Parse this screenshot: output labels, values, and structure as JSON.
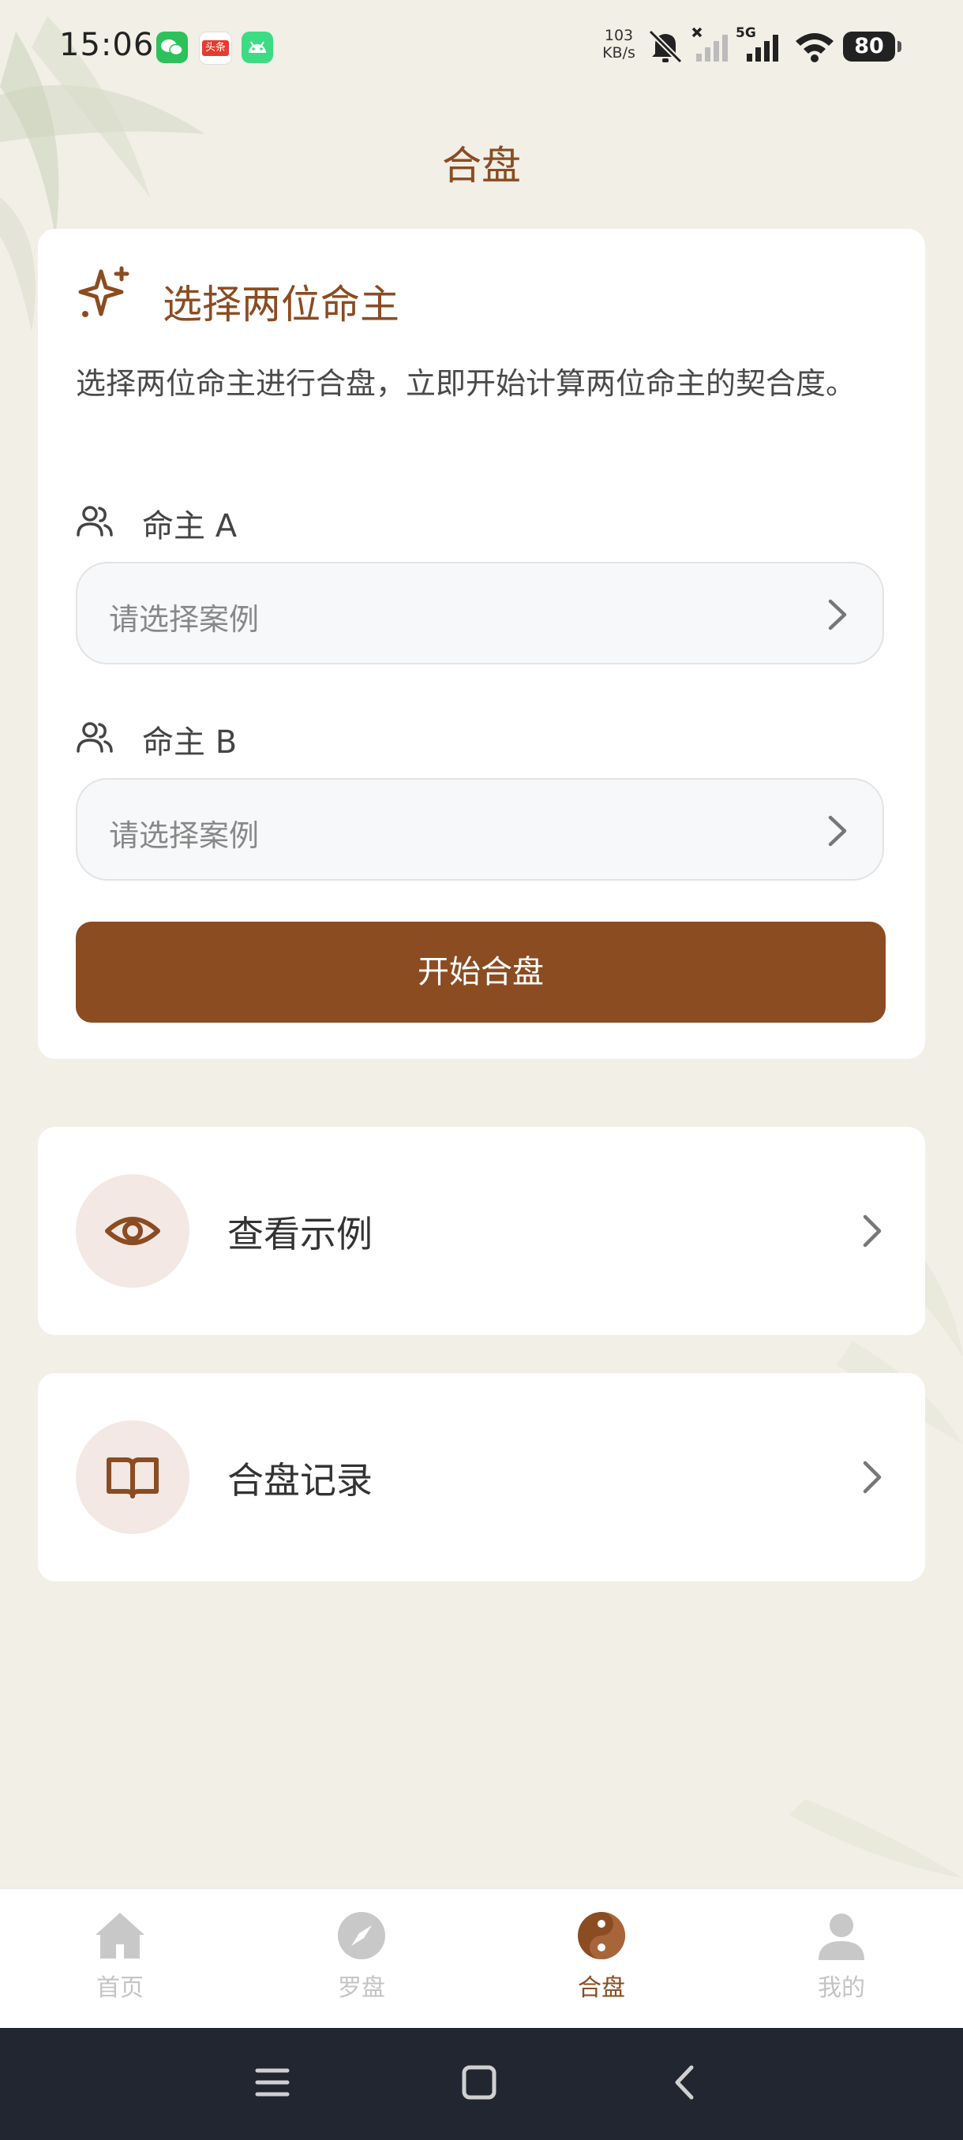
{
  "status_bar": {
    "time": "15:06",
    "net_speed_value": "103",
    "net_speed_unit": "KB/s",
    "network_type": "5G",
    "battery": "80",
    "notification_icons": [
      "wechat-icon",
      "toutiao-icon",
      "android-icon"
    ],
    "toutiao_label": "头条"
  },
  "page": {
    "title": "合盘"
  },
  "select_card": {
    "title": "选择两位命主",
    "description": "选择两位命主进行合盘，立即开始计算两位命主的契合度。",
    "person_a_label": "命主 A",
    "person_a_placeholder": "请选择案例",
    "person_b_label": "命主 B",
    "person_b_placeholder": "请选择案例",
    "start_button": "开始合盘"
  },
  "menu_rows": [
    {
      "label": "查看示例",
      "icon": "eye-icon"
    },
    {
      "label": "合盘记录",
      "icon": "book-icon"
    }
  ],
  "tab_bar": {
    "active_index": 2,
    "items": [
      {
        "label": "首页",
        "icon": "home-icon"
      },
      {
        "label": "罗盘",
        "icon": "compass-icon"
      },
      {
        "label": "合盘",
        "icon": "yin-yang-icon"
      },
      {
        "label": "我的",
        "icon": "user-icon"
      }
    ]
  },
  "colors": {
    "accent": "#8b4c22",
    "background": "#f2efe7",
    "tab_inactive": "#c4c4c4",
    "nav_bar": "#222631"
  }
}
